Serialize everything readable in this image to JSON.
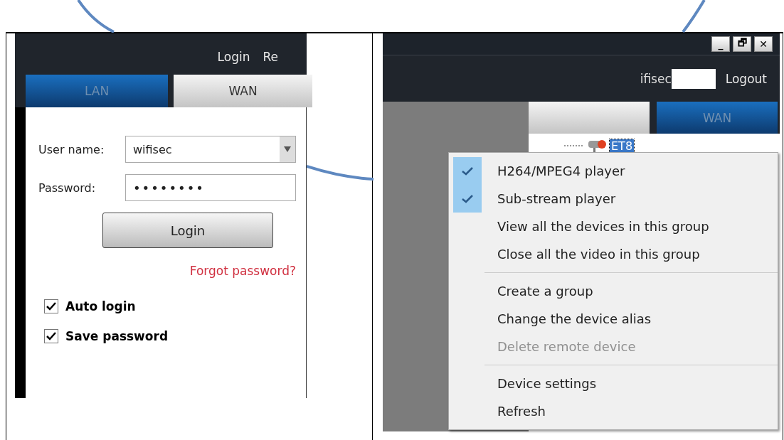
{
  "login_window": {
    "header_links": [
      "Login",
      "Re"
    ],
    "tabs": [
      {
        "label": "LAN",
        "selected": false
      },
      {
        "label": "WAN",
        "selected": true
      }
    ],
    "username": {
      "label": "User name:",
      "value": "wifisec"
    },
    "password": {
      "label": "Password:",
      "value": "••••••••"
    },
    "login_button": "Login",
    "forgot_link": "Forgot password?",
    "options": [
      {
        "label": "Auto login",
        "checked": true
      },
      {
        "label": "Save password",
        "checked": true
      }
    ]
  },
  "main_window": {
    "window_buttons": [
      "_",
      "🗗",
      "✕"
    ],
    "user": "ifisec",
    "logout": "Logout",
    "tabs": [
      {
        "selected": true
      },
      {
        "label": "WAN",
        "selected": false
      }
    ],
    "tree": [
      {
        "label": "ET8",
        "selected": true
      }
    ],
    "context_menu": [
      [
        {
          "label": "H264/MPEG4 player",
          "checked": true,
          "disabled": false
        },
        {
          "label": "Sub-stream player",
          "checked": true,
          "disabled": false
        },
        {
          "label": "View all the devices in this group",
          "checked": false,
          "disabled": false
        },
        {
          "label": "Close all the video in this group",
          "checked": false,
          "disabled": false
        }
      ],
      [
        {
          "label": "Create a group",
          "checked": false,
          "disabled": false
        },
        {
          "label": "Change the device alias",
          "checked": false,
          "disabled": false
        },
        {
          "label": "Delete remote device",
          "checked": false,
          "disabled": true
        }
      ],
      [
        {
          "label": "Device settings",
          "checked": false,
          "disabled": false
        },
        {
          "label": "Refresh",
          "checked": false,
          "disabled": false
        }
      ]
    ]
  }
}
